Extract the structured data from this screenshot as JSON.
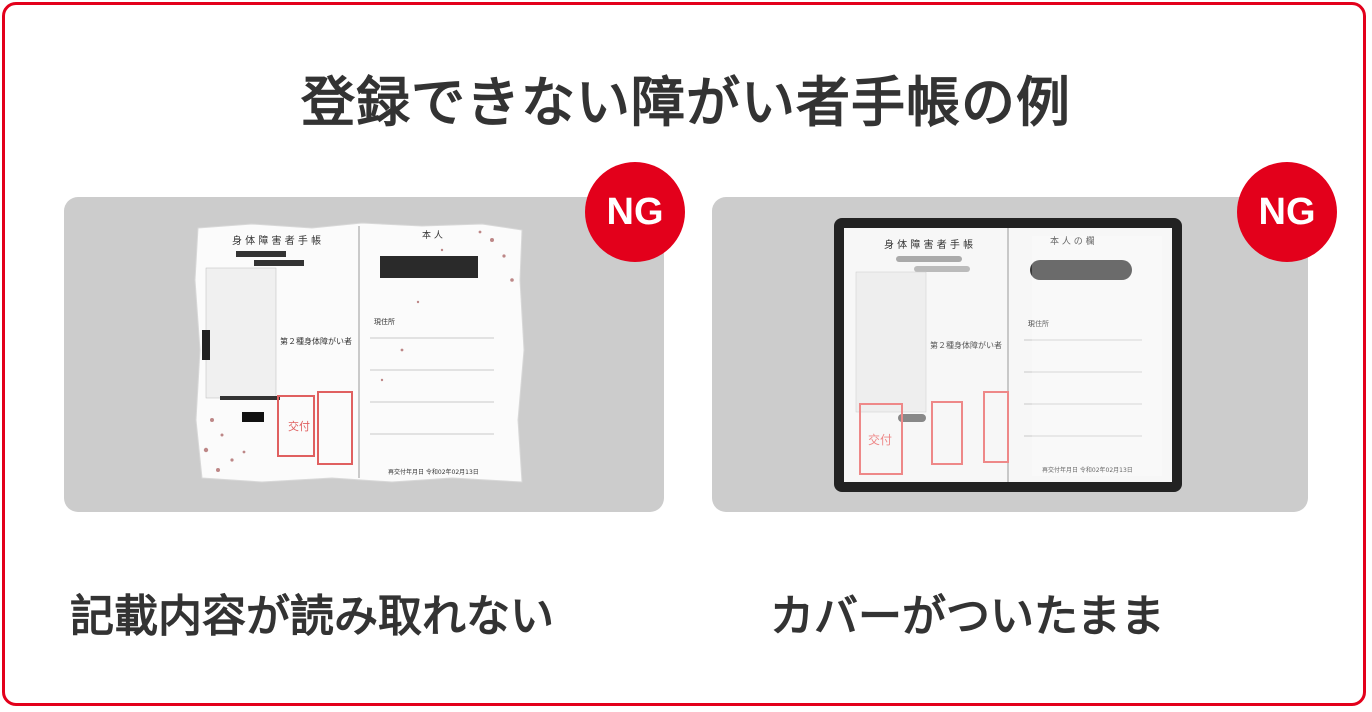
{
  "title": "登録できない障がい者手帳の例",
  "examples": [
    {
      "badge": "NG",
      "caption": "記載内容が読み取れない",
      "card": {
        "left_header": "身 体 障 害 者 手 帳",
        "right_header": "本  人",
        "grade_label": "第２種身体障がい者",
        "reissue": "再交付年月日  令和02年02月13日",
        "address_label": "現住所",
        "stamp_text": "交付"
      }
    },
    {
      "badge": "NG",
      "caption": "カバーがついたまま",
      "card": {
        "left_header": "身 体 障 害 者 手 帳",
        "right_header": "本  人  の  欄",
        "grade_label": "第２種身体障がい者",
        "reissue": "再交付年月日  令和02年02月13日",
        "address_label": "現住所",
        "stamp_text": "交付"
      }
    }
  ],
  "colors": {
    "brand_red": "#e3001b",
    "panel_gray": "#cccccc",
    "text_dark": "#333333"
  }
}
